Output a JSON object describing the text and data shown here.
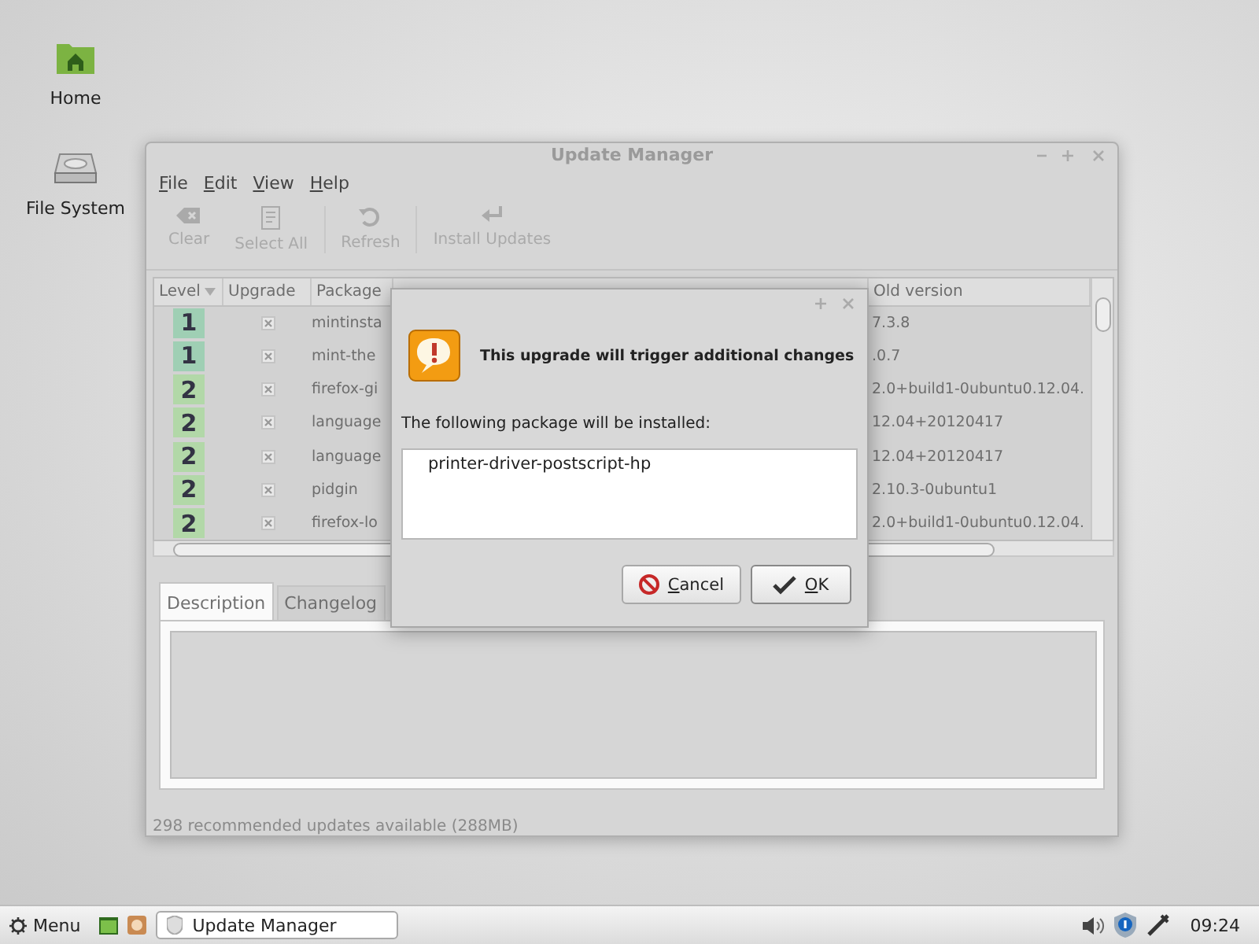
{
  "desktop_icons": [
    {
      "label": "Home",
      "kind": "home"
    },
    {
      "label": "File System",
      "kind": "drive"
    }
  ],
  "window": {
    "title": "Update Manager",
    "menu": [
      "File",
      "Edit",
      "View",
      "Help"
    ],
    "toolbar": [
      {
        "label": "Clear",
        "kind": "clear",
        "disabled": true
      },
      {
        "label": "Select All",
        "kind": "select",
        "disabled": true
      },
      {
        "label": "Refresh",
        "kind": "refresh",
        "disabled": true
      },
      {
        "label": "Install Updates",
        "kind": "install",
        "disabled": true
      }
    ],
    "table": {
      "columns": [
        {
          "label": "Level",
          "sorted": true
        },
        {
          "label": "Upgrade",
          "sorted": false
        },
        {
          "label": "Package",
          "sorted": false
        },
        {
          "label": "Old version",
          "sorted": false
        }
      ],
      "rows": [
        {
          "level": "1",
          "color": "#9fcfb4",
          "checked": true,
          "package": "mintinsta",
          "old_version": "7.3.8"
        },
        {
          "level": "1",
          "color": "#9fcfb4",
          "checked": true,
          "package": "mint-the",
          "old_version": ".0.7"
        },
        {
          "level": "2",
          "color": "#b2d8a8",
          "checked": true,
          "package": "firefox-gi",
          "old_version": "2.0+build1-0ubuntu0.12.04."
        },
        {
          "level": "2",
          "color": "#b2d8a8",
          "checked": true,
          "package": "language",
          "old_version": "12.04+20120417"
        },
        {
          "level": "2",
          "color": "#b2d8a8",
          "checked": true,
          "package": "language",
          "old_version": "12.04+20120417"
        },
        {
          "level": "2",
          "color": "#b2d8a8",
          "checked": true,
          "package": "pidgin",
          "old_version": "2.10.3-0ubuntu1"
        },
        {
          "level": "2",
          "color": "#b2d8a8",
          "checked": true,
          "package": "firefox-lo",
          "old_version": "2.0+build1-0ubuntu0.12.04."
        }
      ]
    },
    "tabs": [
      {
        "label": "Description",
        "selected": true
      },
      {
        "label": "Changelog",
        "selected": false
      }
    ],
    "status_bar": "298 recommended updates available (288MB)"
  },
  "dialog": {
    "heading": "This upgrade will trigger additional changes",
    "message": "The following package will be installed:",
    "packages": [
      "printer-driver-postscript-hp"
    ],
    "buttons": [
      {
        "label": "Cancel",
        "kind": "cancel"
      },
      {
        "label": "OK",
        "kind": "ok"
      }
    ]
  },
  "taskbar": {
    "menu": "Menu",
    "window_button": "Update Manager",
    "clock": "09:24"
  }
}
